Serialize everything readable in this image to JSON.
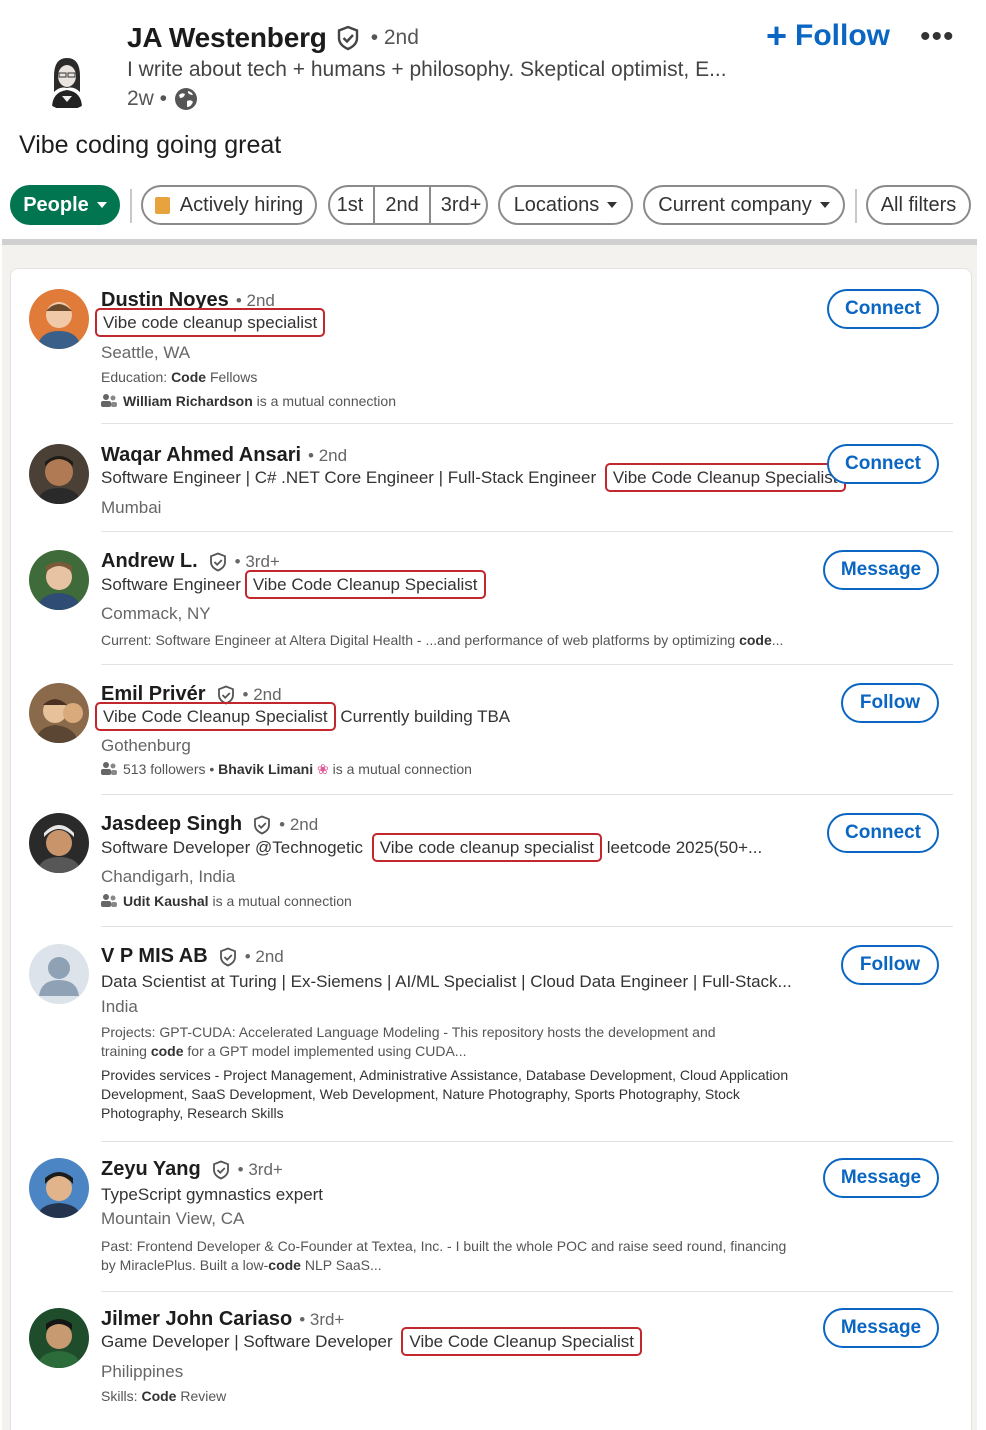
{
  "post": {
    "author_name": "JA Westenberg",
    "degree": "• 2nd",
    "headline": "I write about tech + humans + philosophy. Skeptical optimist, E...",
    "time": "2w •",
    "follow_label": "Follow",
    "text": "Vibe coding going great"
  },
  "filters": {
    "people": "People",
    "hiring": "Actively hiring",
    "first": "1st",
    "second": "2nd",
    "third": "3rd+",
    "locations": "Locations",
    "company": "Current company",
    "all": "All filters"
  },
  "results": [
    {
      "name": "Dustin Noyes",
      "degree": "• 2nd",
      "title_pre": "",
      "title_hl": "Vibe code cleanup specialist",
      "title_post": "",
      "location": "Seattle, WA",
      "extra1_label": "Education: ",
      "extra1_bold": "Code",
      "extra1_text": " Fellows",
      "mutual_name": "William Richardson",
      "mutual_text": " is a mutual connection",
      "action": "Connect"
    },
    {
      "name": "Waqar Ahmed Ansari",
      "degree": "• 2nd",
      "title_pre": "Software Engineer | C# .NET Core Engineer | Full-Stack Engineer",
      "title_hl": "Vibe Code Cleanup Specialist",
      "title_post": "",
      "location": "Mumbai",
      "action": "Connect"
    },
    {
      "name": "Andrew L.",
      "degree": "• 3rd+",
      "title_pre": "Software Engineer",
      "title_hl": "Vibe Code Cleanup Specialist",
      "title_post": "",
      "location": "Commack, NY",
      "extra1_label": "Current: Software Engineer at Altera Digital Health - ...and performance of web platforms by optimizing ",
      "extra1_bold": "code",
      "extra1_text": "...",
      "action": "Message"
    },
    {
      "name": "Emil Privér",
      "degree": "• 2nd",
      "title_pre": "",
      "title_hl": "Vibe Code Cleanup Specialist",
      "title_post": "Currently building TBA",
      "location": "Gothenburg",
      "mutual_pre": "513 followers • ",
      "mutual_name": "Bhavik Limani",
      "mutual_text": " is a mutual connection",
      "action": "Follow"
    },
    {
      "name": "Jasdeep Singh",
      "degree": "• 2nd",
      "title_pre": "Software Developer @Technogetic",
      "title_hl": "Vibe code cleanup specialist",
      "title_post": "leetcode 2025(50+...",
      "location": "Chandigarh, India",
      "mutual_name": "Udit Kaushal",
      "mutual_text": " is a mutual connection",
      "action": "Connect"
    },
    {
      "name": "V P MIS AB",
      "degree": "• 2nd",
      "title_pre": "Data Scientist at Turing | Ex-Siemens | AI/ML Specialist | Cloud Data Engineer | Full-Stack...",
      "title_hl": "",
      "title_post": "",
      "location": "India",
      "projects_1": "Projects: GPT-CUDA: Accelerated Language Modeling - This repository hosts the development and",
      "projects_2a": "training ",
      "projects_2b": "code",
      "projects_2c": " for a GPT model implemented using CUDA...",
      "services_1": "Provides services - Project Management, Administrative Assistance, Database Development, Cloud Application",
      "services_2": "Development, SaaS Development, Web Development, Nature Photography, Sports Photography, Stock",
      "services_3": "Photography, Research Skills",
      "action": "Follow"
    },
    {
      "name": "Zeyu Yang",
      "degree": "• 3rd+",
      "title_pre": "TypeScript gymnastics expert",
      "title_hl": "",
      "title_post": "",
      "location": "Mountain View, CA",
      "past_1": "Past: Frontend Developer & Co-Founder at Textea, Inc. - I built the whole POC and raise seed round, financing",
      "past_2a": "by MiraclePlus. Built a low-",
      "past_2b": "code",
      "past_2c": " NLP SaaS...",
      "action": "Message"
    },
    {
      "name": "Jilmer John Cariaso",
      "degree": "• 3rd+",
      "title_pre": "Game Developer | Software Developer",
      "title_hl": "Vibe Code Cleanup Specialist",
      "title_post": "",
      "location": "Philippines",
      "extra1_label": "Skills: ",
      "extra1_bold": "Code",
      "extra1_text": " Review",
      "action": "Message"
    }
  ],
  "colors": {
    "linkedin_blue": "#0a66c2",
    "people_green": "#01754f",
    "highlight_red": "#c1272d"
  }
}
